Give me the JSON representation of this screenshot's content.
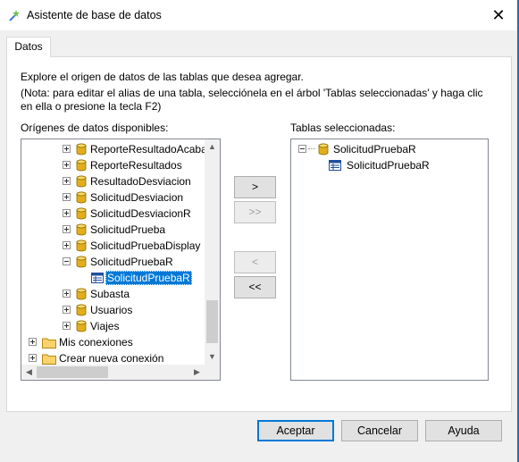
{
  "window": {
    "title": "Asistente de base de datos",
    "close_glyph": "✕"
  },
  "tabs": [
    {
      "label": "Datos"
    }
  ],
  "instructions": {
    "line1": "Explore el origen de datos de las tablas que desea agregar.",
    "line2": "(Nota: para editar el alias de una tabla, selecciónela en el árbol 'Tablas seleccionadas' y haga clic en ella o presione la tecla F2)"
  },
  "sources": {
    "label": "Orígenes de datos disponibles:",
    "items": [
      {
        "label": "ReporteResultadoAcaba",
        "icon": "database-icon",
        "expander": "plus"
      },
      {
        "label": "ReporteResultados",
        "icon": "database-icon",
        "expander": "plus"
      },
      {
        "label": "ResultadoDesviacion",
        "icon": "database-icon",
        "expander": "plus"
      },
      {
        "label": "SolicitudDesviacion",
        "icon": "database-icon",
        "expander": "plus"
      },
      {
        "label": "SolicitudDesviacionR",
        "icon": "database-icon",
        "expander": "plus"
      },
      {
        "label": "SolicitudPrueba",
        "icon": "database-icon",
        "expander": "plus"
      },
      {
        "label": "SolicitudPruebaDisplay",
        "icon": "database-icon",
        "expander": "plus"
      },
      {
        "label": "SolicitudPruebaR",
        "icon": "database-icon",
        "expander": "minus"
      },
      {
        "label": "SolicitudPruebaR",
        "icon": "table-icon",
        "expander": "none",
        "selected": true
      },
      {
        "label": "Subasta",
        "icon": "database-icon",
        "expander": "plus"
      },
      {
        "label": "Usuarios",
        "icon": "database-icon",
        "expander": "plus"
      },
      {
        "label": "Viajes",
        "icon": "database-icon",
        "expander": "plus"
      },
      {
        "label": "Mis conexiones",
        "icon": "folder-icon",
        "expander": "plus"
      },
      {
        "label": "Crear nueva conexión",
        "icon": "folder-icon",
        "expander": "plus"
      }
    ]
  },
  "selected_tables": {
    "label": "Tablas seleccionadas:",
    "items": [
      {
        "label": "SolicitudPruebaR",
        "icon": "database-icon",
        "expander": "minus"
      },
      {
        "label": "SolicitudPruebaR",
        "icon": "table-icon",
        "expander": "none"
      }
    ]
  },
  "move_buttons": {
    "add": ">",
    "add_all": ">>",
    "remove": "<",
    "remove_all": "<<"
  },
  "dialog_buttons": {
    "ok": "Aceptar",
    "cancel": "Cancelar",
    "help": "Ayuda"
  },
  "colors": {
    "selection": "#0078d7",
    "default_button_border": "#0078d7"
  }
}
